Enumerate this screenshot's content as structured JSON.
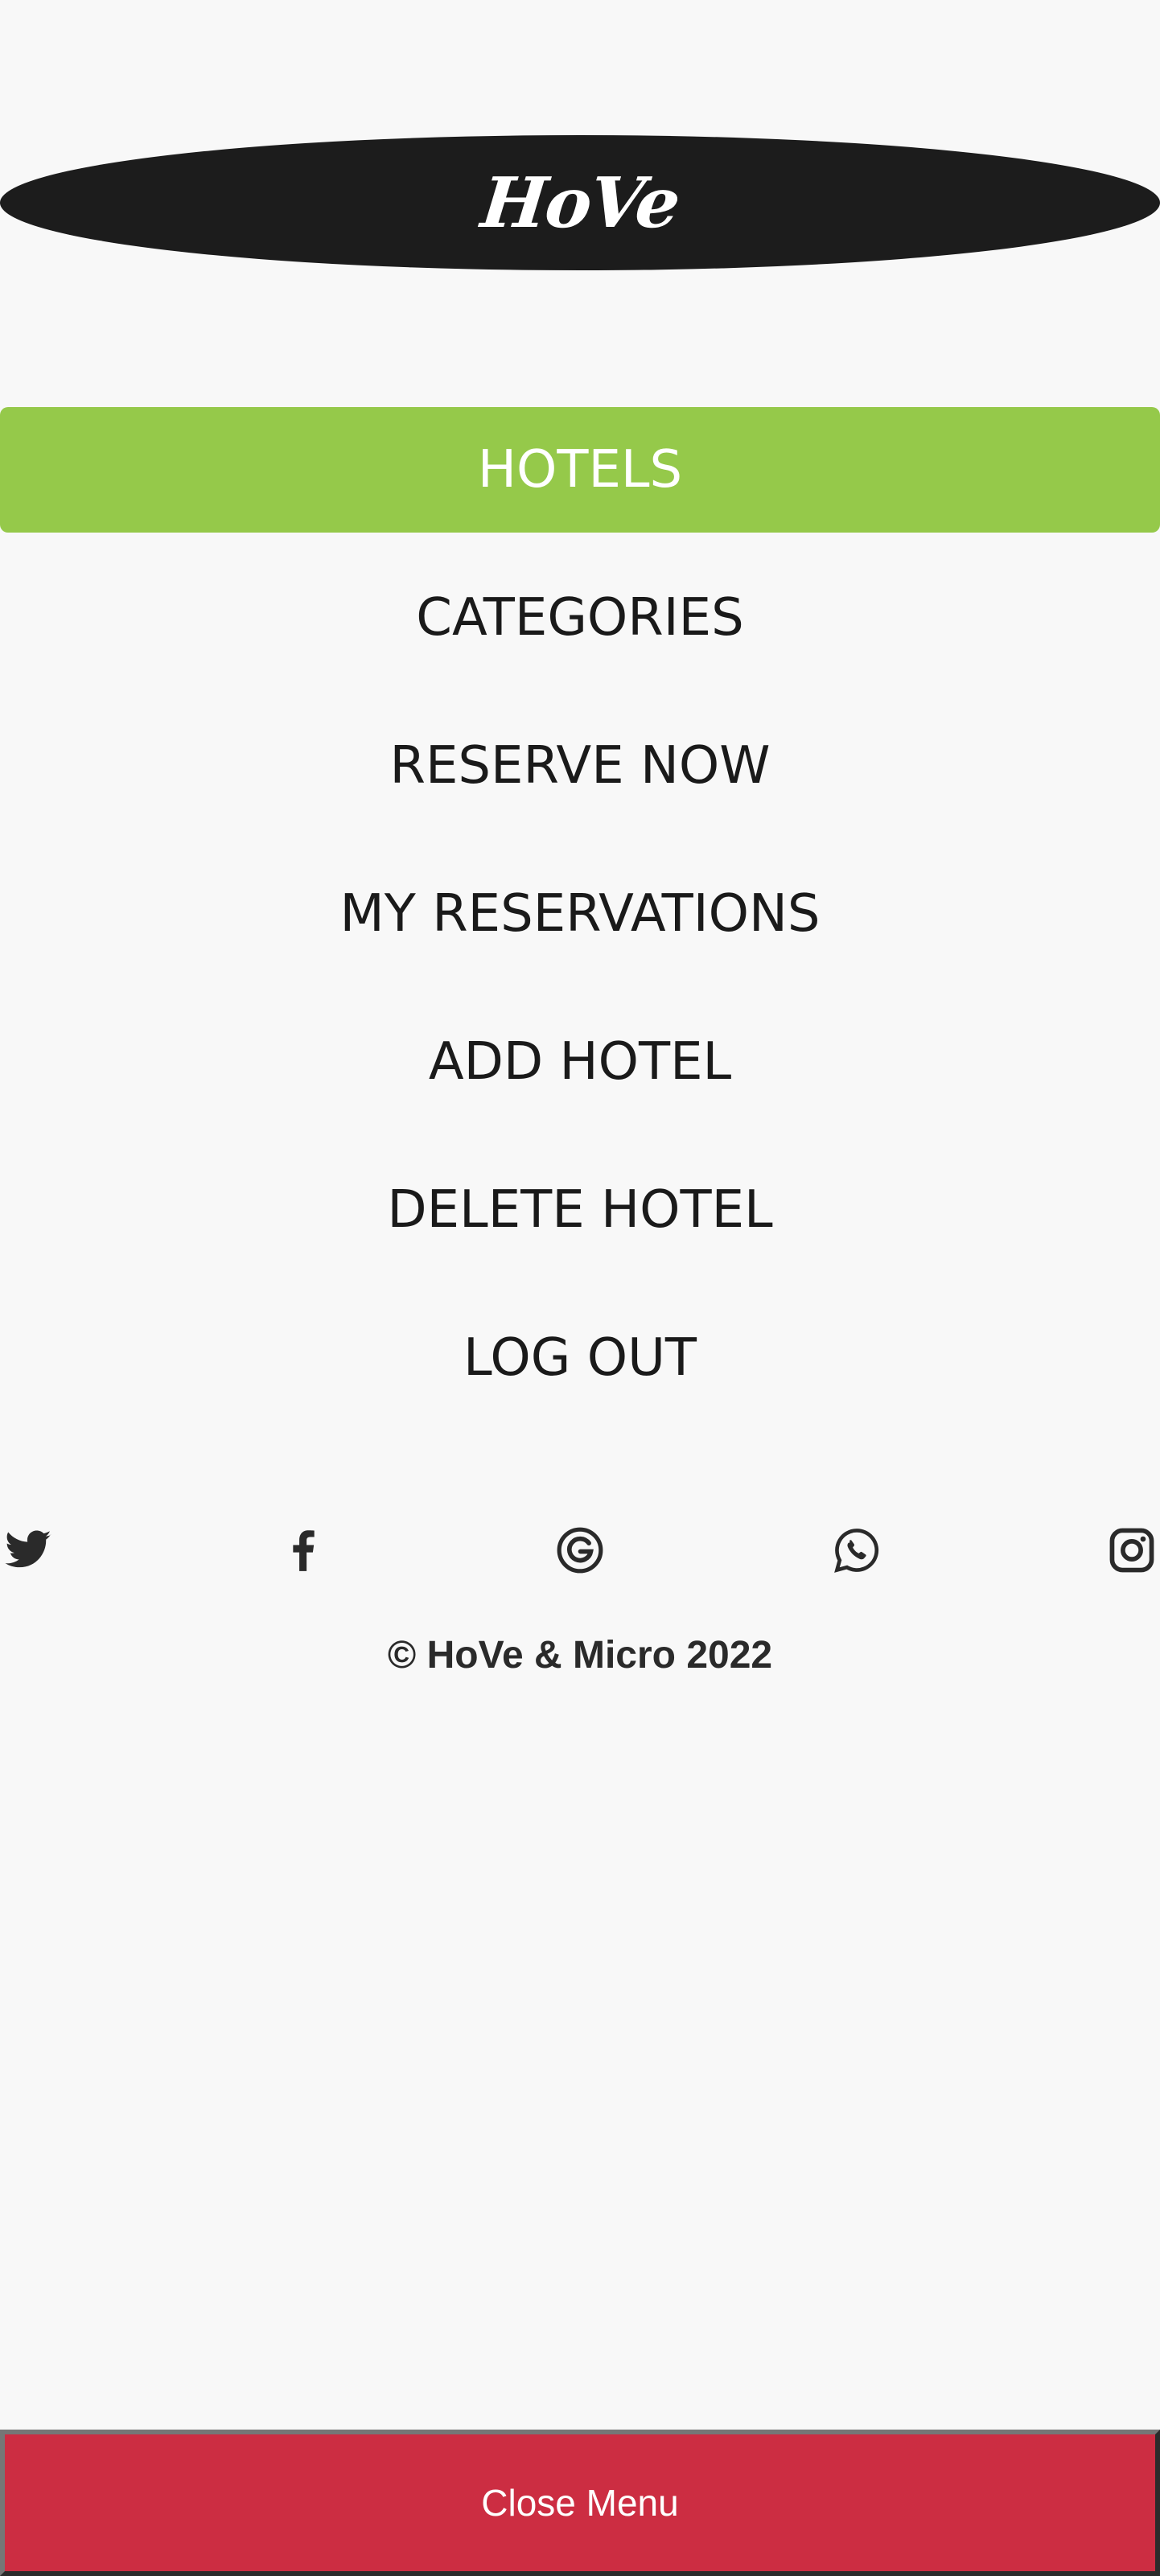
{
  "logo": {
    "text": "HoVe"
  },
  "nav": {
    "items": [
      {
        "label": "HOTELS",
        "active": true
      },
      {
        "label": "CATEGORIES"
      },
      {
        "label": "RESERVE NOW"
      },
      {
        "label": "MY RESERVATIONS"
      },
      {
        "label": "ADD HOTEL"
      },
      {
        "label": "DELETE HOTEL"
      },
      {
        "label": "LOG OUT"
      }
    ]
  },
  "socials": [
    {
      "icon": "twitter-icon"
    },
    {
      "icon": "facebook-icon"
    },
    {
      "icon": "google-icon"
    },
    {
      "icon": "whatsapp-icon"
    },
    {
      "icon": "instagram-icon"
    }
  ],
  "footer": {
    "copyright": "© HoVe & Micro 2022"
  },
  "close_menu": {
    "label": "Close Menu"
  },
  "colors": {
    "background": "#f8f8f8",
    "logo_bg": "#1c1c1c",
    "active_nav": "#95c94a",
    "close_button": "#cc2d42",
    "text": "#1a1a1a"
  }
}
